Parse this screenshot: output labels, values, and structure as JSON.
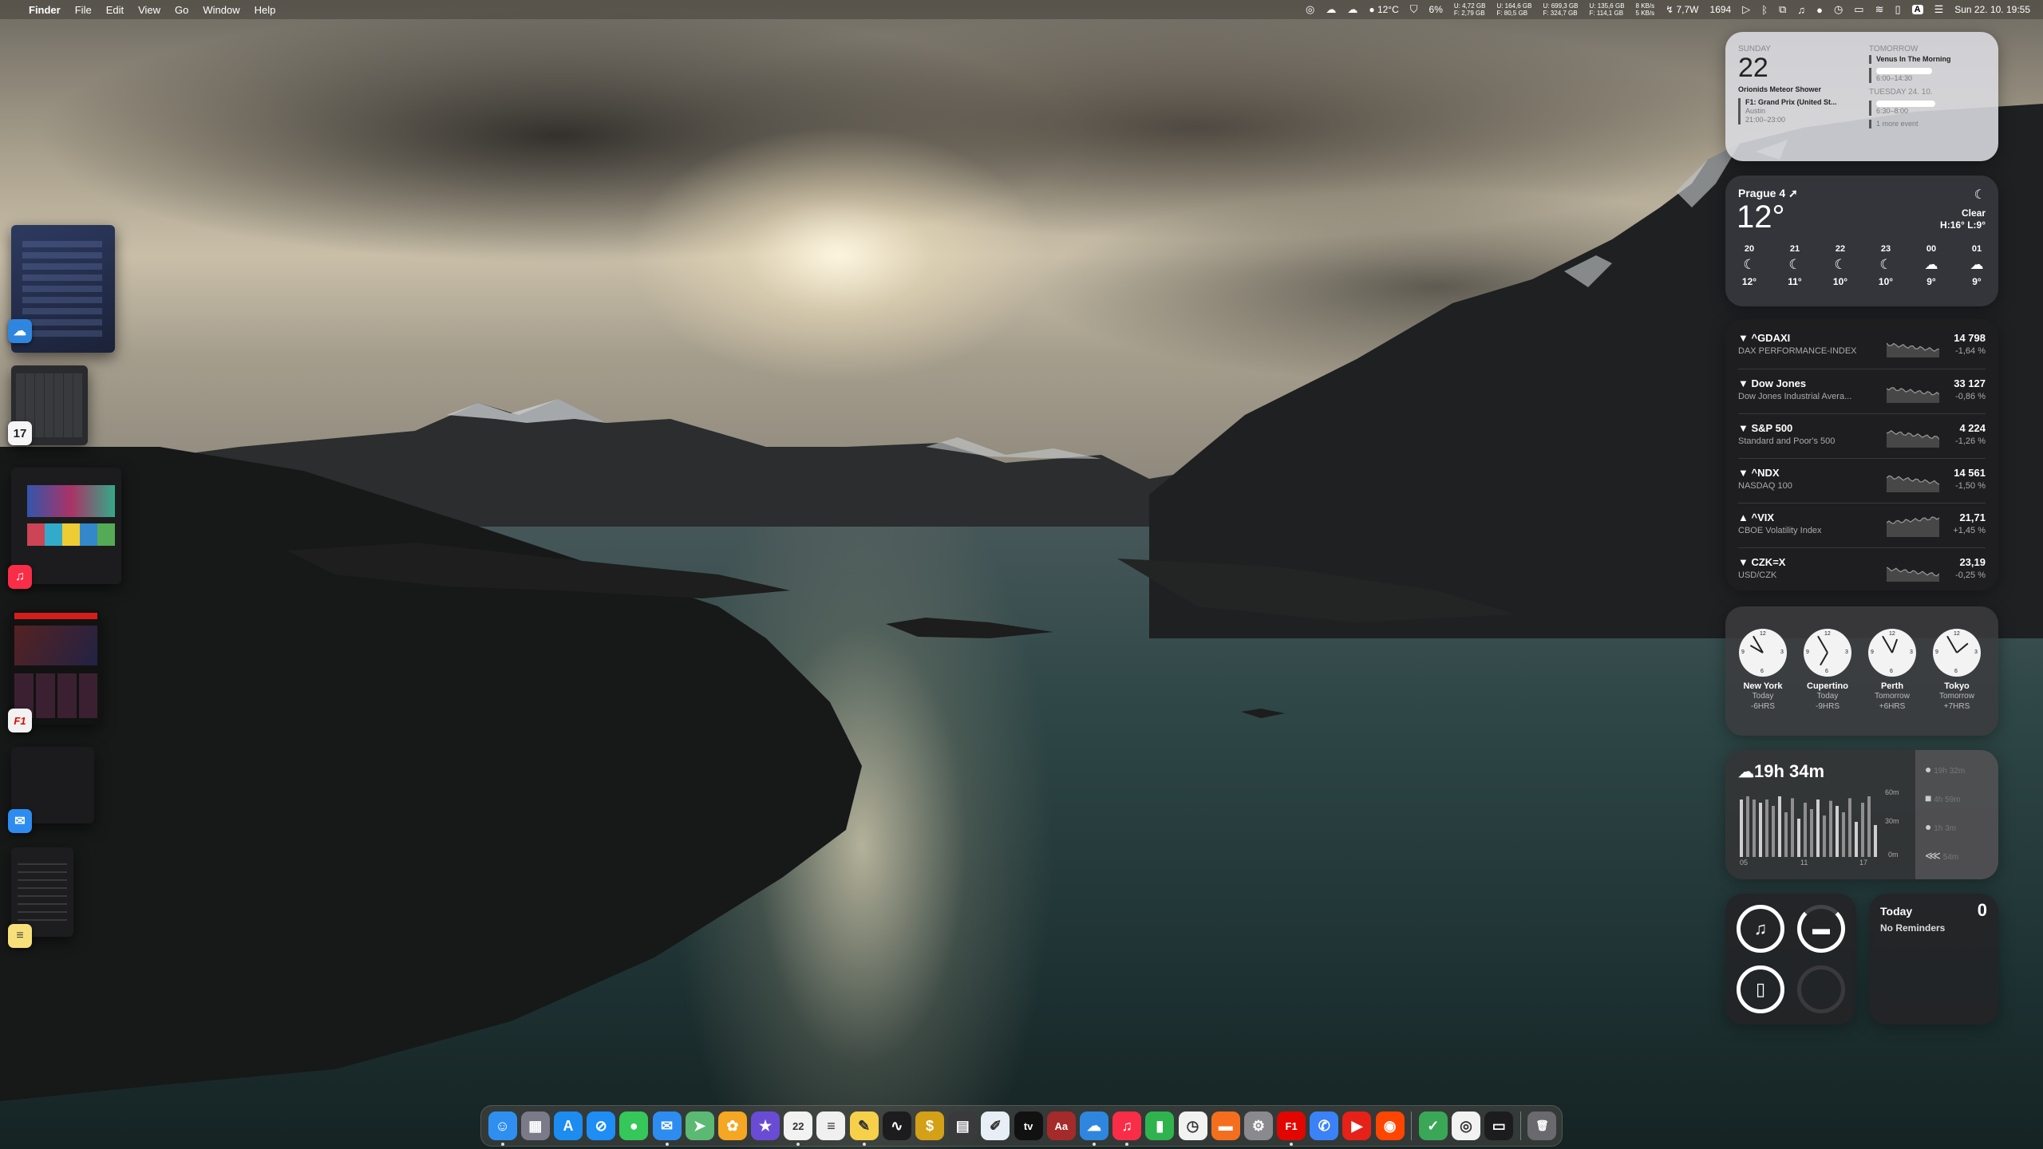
{
  "menubar": {
    "apple": "",
    "app_name": "Finder",
    "menus": [
      "File",
      "Edit",
      "View",
      "Go",
      "Window",
      "Help"
    ],
    "weather": "12°C",
    "battery_pct": "6%",
    "disk_stats": [
      "U: 4,72 GB",
      "F: 2,79 GB",
      "U: 164,6 GB",
      "F: 80,5 GB",
      "U: 699,3 GB",
      "F: 324,7 GB",
      "U: 135,6 GB",
      "F: 114,1 GB"
    ],
    "net_stats": [
      "8 KB/s",
      "5 KB/s"
    ],
    "power": "7,7W",
    "counter": "1694",
    "datetime": "Sun 22. 10.  19:55"
  },
  "calendar_widget": {
    "day_label": "SUNDAY",
    "day_number": "22",
    "today_events": [
      {
        "title": "Orionids Meteor Shower"
      },
      {
        "title": "F1: Grand Prix (United St...",
        "location": "Austin",
        "time": "21:00–23:00"
      }
    ],
    "tomorrow_label": "TOMORROW",
    "tomorrow_events": [
      {
        "title": "Venus In The Morning"
      },
      {
        "title": "",
        "time": "6:00–14:30"
      }
    ],
    "tuesday_label": "TUESDAY 24. 10.",
    "tuesday_events": [
      {
        "title": "",
        "time": "6:30–8:00"
      }
    ],
    "more": "1 more event"
  },
  "weather_widget": {
    "location": "Prague 4",
    "temp": "12°",
    "condition": "Clear",
    "hilo": "H:16° L:9°",
    "hours": [
      {
        "h": "20",
        "t": "12°",
        "icon": "moon-icon"
      },
      {
        "h": "21",
        "t": "11°",
        "icon": "moon-icon"
      },
      {
        "h": "22",
        "t": "10°",
        "icon": "moon-icon"
      },
      {
        "h": "23",
        "t": "10°",
        "icon": "moon-icon"
      },
      {
        "h": "00",
        "t": "9°",
        "icon": "moon-cloud-icon"
      },
      {
        "h": "01",
        "t": "9°",
        "icon": "cloud-icon"
      }
    ]
  },
  "stocks": [
    {
      "symbol": "▼ ^GDAXI",
      "name": "DAX PERFORMANCE-INDEX",
      "price": "14 798",
      "change": "-1,64 %"
    },
    {
      "symbol": "▼ Dow Jones",
      "name": "Dow Jones Industrial Avera...",
      "price": "33 127",
      "change": "-0,86 %"
    },
    {
      "symbol": "▼ S&P 500",
      "name": "Standard and Poor's 500",
      "price": "4 224",
      "change": "-1,26 %"
    },
    {
      "symbol": "▼ ^NDX",
      "name": "NASDAQ 100",
      "price": "14 561",
      "change": "-1,50 %"
    },
    {
      "symbol": "▲ ^VIX",
      "name": "CBOE Volatility Index",
      "price": "21,71",
      "change": "+1,45 %"
    },
    {
      "symbol": "▼ CZK=X",
      "name": "USD/CZK",
      "price": "23,19",
      "change": "-0,25 %"
    }
  ],
  "world_clock": [
    {
      "city": "New York",
      "day": "Today",
      "offset": "-6HRS"
    },
    {
      "city": "Cupertino",
      "day": "Today",
      "offset": "-9HRS"
    },
    {
      "city": "Perth",
      "day": "Tomorrow",
      "offset": "+6HRS"
    },
    {
      "city": "Tokyo",
      "day": "Tomorrow",
      "offset": "+7HRS"
    }
  ],
  "screen_time": {
    "total": "19h 34m",
    "y_labels": [
      "60m",
      "30m",
      "0m"
    ],
    "x_labels": [
      "05",
      "11",
      "17"
    ],
    "apps": [
      "19h 32m",
      "4h 59m",
      "1h 3m",
      "54m"
    ]
  },
  "battery_widget": {
    "devices": [
      {
        "icon": "airpods-icon",
        "level": 0.9
      },
      {
        "icon": "airpods-case-icon",
        "level": 0.85
      },
      {
        "icon": "mouse-icon",
        "level": 0.95
      },
      {
        "icon": "empty-icon",
        "level": 0
      }
    ]
  },
  "reminders": {
    "title": "Today",
    "count": "0",
    "empty": "No Reminders"
  },
  "dock": {
    "apps": [
      {
        "name": "Finder",
        "glyph": "☺",
        "color": "#2f8ff0",
        "running": true
      },
      {
        "name": "Launchpad",
        "glyph": "▦",
        "color": "#7a7a88",
        "running": false
      },
      {
        "name": "App Store",
        "glyph": "A",
        "color": "#1c8cf0",
        "running": false
      },
      {
        "name": "Safari",
        "glyph": "⊘",
        "color": "#1e8df5",
        "running": false
      },
      {
        "name": "Messages",
        "glyph": "●",
        "color": "#35c759",
        "running": false
      },
      {
        "name": "Mail",
        "glyph": "✉",
        "color": "#2d8cf0",
        "running": true
      },
      {
        "name": "Maps",
        "glyph": "➤",
        "color": "#5bb974",
        "running": false
      },
      {
        "name": "Photos",
        "glyph": "✿",
        "color": "#f5a623",
        "running": false
      },
      {
        "name": "iMovie",
        "glyph": "★",
        "color": "#6a4cd4",
        "running": false
      },
      {
        "name": "Calendar",
        "glyph": "22",
        "color": "#f2f2f2",
        "running": true
      },
      {
        "name": "Reminders",
        "glyph": "≡",
        "color": "#f0f0f0",
        "running": false
      },
      {
        "name": "Notes",
        "glyph": "✎",
        "color": "#f7d04a",
        "running": true
      },
      {
        "name": "Stocks",
        "glyph": "∿",
        "color": "#1c1c1e",
        "running": false
      },
      {
        "name": "Money",
        "glyph": "$",
        "color": "#d4a017",
        "running": false
      },
      {
        "name": "Calculator",
        "glyph": "▤",
        "color": "#3a3a3c",
        "running": false
      },
      {
        "name": "Freeform",
        "glyph": "✐",
        "color": "#e8eef6",
        "running": false
      },
      {
        "name": "TV",
        "glyph": "tv",
        "color": "#111111",
        "running": false
      },
      {
        "name": "Dictionary",
        "glyph": "Aa",
        "color": "#a52a2a",
        "running": false
      },
      {
        "name": "Weather",
        "glyph": "☁",
        "color": "#2f86de",
        "running": true
      },
      {
        "name": "Music",
        "glyph": "♫",
        "color": "#fa2d48",
        "running": true
      },
      {
        "name": "Numbers",
        "glyph": "▮",
        "color": "#2fb34e",
        "running": false
      },
      {
        "name": "Clock",
        "glyph": "◷",
        "color": "#f2f2f2",
        "running": false
      },
      {
        "name": "Books",
        "glyph": "▬",
        "color": "#f56e1e",
        "running": false
      },
      {
        "name": "System Settings",
        "glyph": "⚙",
        "color": "#8a8a8e",
        "running": false
      },
      {
        "name": "F1 TV",
        "glyph": "F1",
        "color": "#e10600",
        "running": true
      },
      {
        "name": "Messenger",
        "glyph": "✆",
        "color": "#3b82f6",
        "running": false
      },
      {
        "name": "YouTube",
        "glyph": "▶",
        "color": "#e62117",
        "running": false
      },
      {
        "name": "Reddit",
        "glyph": "◉",
        "color": "#ff4500",
        "running": false
      }
    ],
    "utils": [
      {
        "name": "AdGuard",
        "glyph": "✓",
        "color": "#3aa757",
        "running": false
      },
      {
        "name": "ChatGPT",
        "glyph": "◎",
        "color": "#f2f2f2",
        "running": false
      },
      {
        "name": "Activity Monitor",
        "glyph": "▭",
        "color": "#1c1c1e",
        "running": false
      }
    ],
    "trash": {
      "name": "Trash",
      "glyph": "🗑",
      "color": "#6a6a6e"
    }
  },
  "colors": {
    "accent": "#2f8ff0",
    "widget_bg": "#303032",
    "stock_down": "#aaaaaa"
  }
}
